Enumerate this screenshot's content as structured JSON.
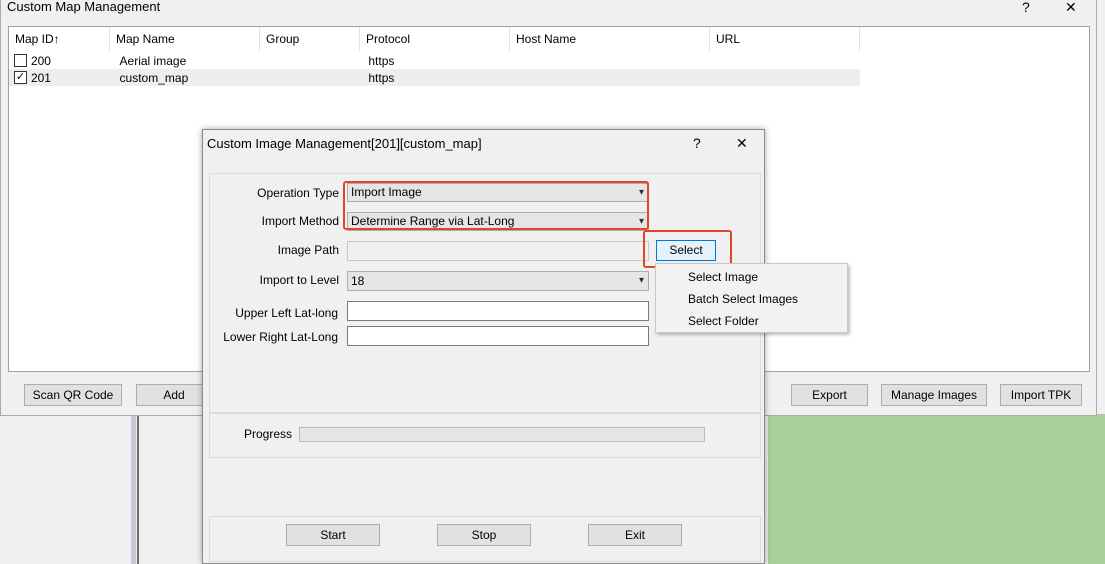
{
  "main": {
    "title": "Custom Map Management",
    "help": "?",
    "close": "✕",
    "columns": [
      "Map ID↑",
      "Map Name",
      "Group",
      "Protocol",
      "Host Name",
      "URL"
    ],
    "rows": [
      {
        "id": "200",
        "name": "Aerial image",
        "group": "",
        "protocol": "https",
        "host": "",
        "url": "",
        "checked": false
      },
      {
        "id": "201",
        "name": "custom_map",
        "group": "",
        "protocol": "https",
        "host": "",
        "url": "",
        "checked": true
      }
    ],
    "buttons": {
      "scan_qr": "Scan QR Code",
      "add": "Add",
      "export": "Export",
      "manage_images": "Manage Images",
      "import_tpk": "Import TPK"
    }
  },
  "dialog": {
    "title": "Custom Image Management[201][custom_map]",
    "help": "?",
    "close": "✕",
    "labels": {
      "operation_type": "Operation Type",
      "import_method": "Import Method",
      "image_path": "Image Path",
      "import_level": "Import to Level",
      "upper_left": "Upper Left Lat-long",
      "lower_right": "Lower Right Lat-Long",
      "progress": "Progress"
    },
    "values": {
      "operation_type": "Import Image",
      "import_method": "Determine Range via Lat-Long",
      "image_path": "",
      "import_level": "18",
      "upper_left": "",
      "lower_right": ""
    },
    "select_button": "Select",
    "buttons": {
      "start": "Start",
      "stop": "Stop",
      "exit": "Exit"
    },
    "progress_value": 0
  },
  "select_menu": {
    "items": [
      "Select Image",
      "Batch Select Images",
      "Select Folder"
    ]
  },
  "colors": {
    "highlight": "#e0472a",
    "map_background": "#a9cf9b",
    "selected_row": "#eeeeee"
  }
}
